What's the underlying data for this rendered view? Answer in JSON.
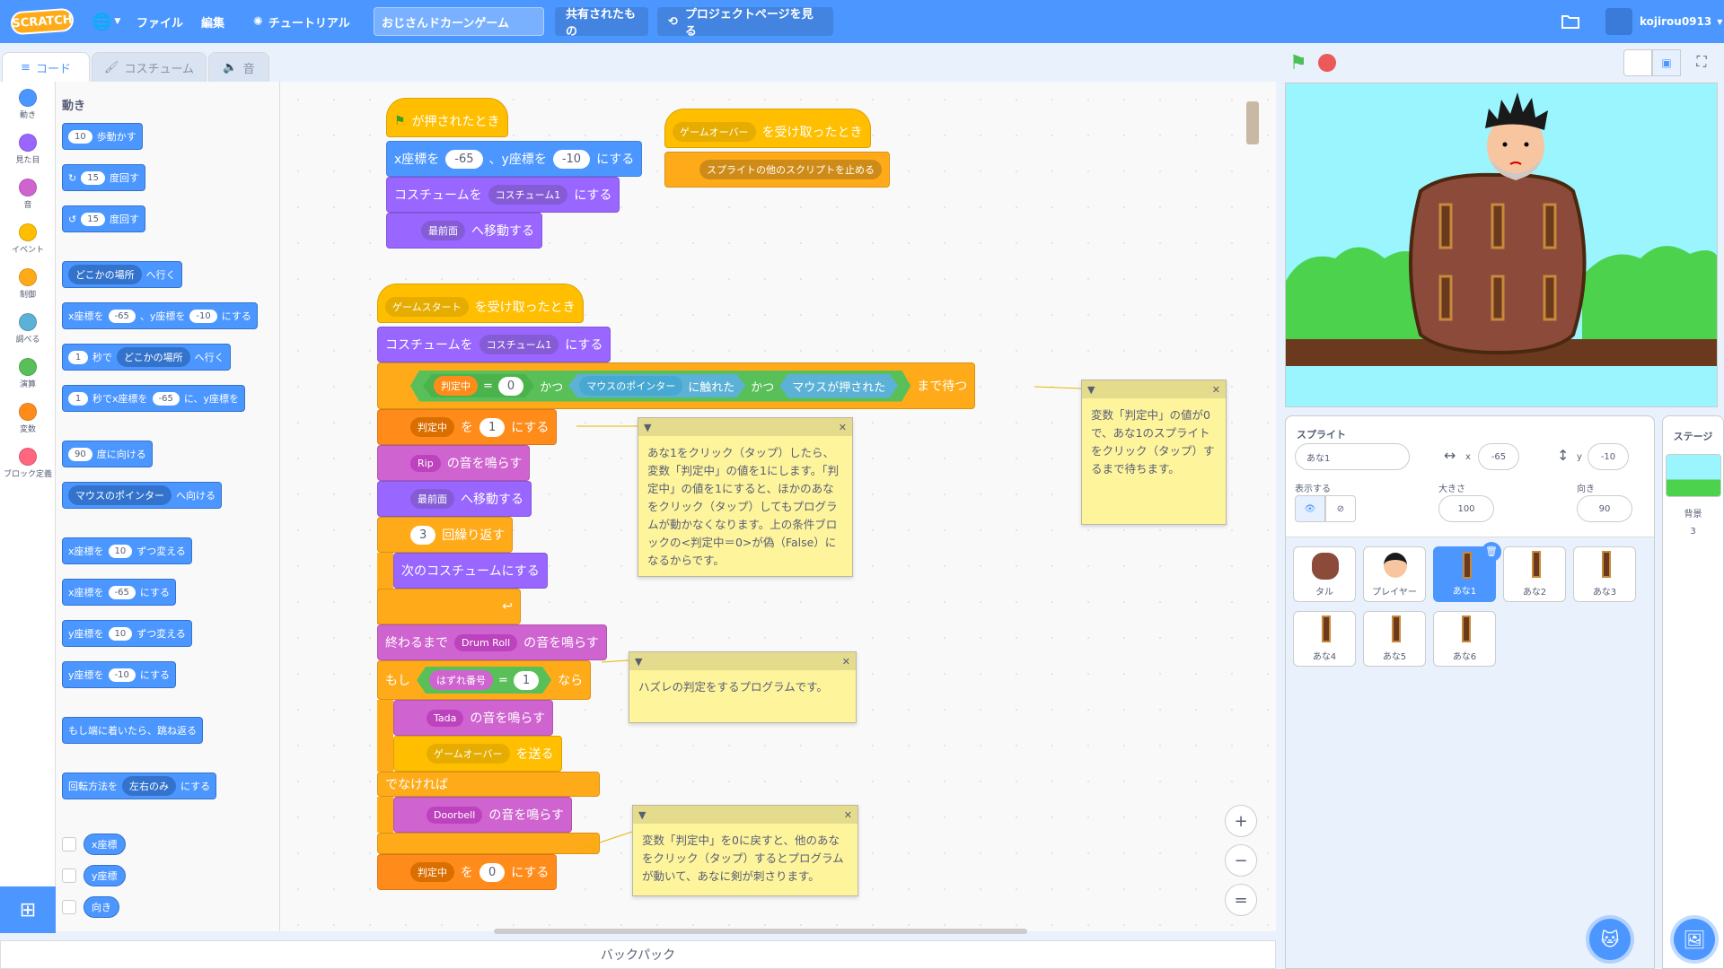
{
  "menubar": {
    "logo": "SCRATCH",
    "globe_icon": "globe-icon",
    "file": "ファイル",
    "edit": "編集",
    "tutorial": "チュートリアル",
    "project_title": "おじさんドカーンゲーム",
    "shared": "共有されたもの",
    "see_project_page": "プロジェクトページを見る",
    "username": "kojirou0913"
  },
  "tabs": {
    "code": "コード",
    "costumes": "コスチューム",
    "sounds": "音"
  },
  "categories": [
    {
      "label": "動き",
      "color": "#4c97ff"
    },
    {
      "label": "見た目",
      "color": "#9966ff"
    },
    {
      "label": "音",
      "color": "#cf63cf"
    },
    {
      "label": "イベント",
      "color": "#ffbf00"
    },
    {
      "label": "制御",
      "color": "#ffab19"
    },
    {
      "label": "調べる",
      "color": "#5cb1d6"
    },
    {
      "label": "演算",
      "color": "#59c059"
    },
    {
      "label": "変数",
      "color": "#ff8c1a"
    },
    {
      "label": "ブロック定義",
      "color": "#ff6680"
    }
  ],
  "palette": {
    "title": "動き",
    "move_n": "10",
    "move_t": "歩動かす",
    "turn_r_n": "15",
    "turn_r_t": "度回す",
    "turn_l_n": "15",
    "turn_l_t": "度回す",
    "goto_dd": "どこかの場所",
    "goto_t": "へ行く",
    "setxy_a": "x座標を",
    "setxy_x": "-65",
    "setxy_b": "、y座標を",
    "setxy_y": "-10",
    "setxy_c": "にする",
    "glide_n": "1",
    "glide_a": "秒で",
    "glide_dd": "どこかの場所",
    "glide_b": "へ行く",
    "glidexy_n": "1",
    "glidexy_a": "秒でx座標を",
    "glidexy_x": "-65",
    "glidexy_b": "に、y座標を",
    "point_n": "90",
    "point_t": "度に向ける",
    "pointto_dd": "マウスのポインター",
    "pointto_t": "へ向ける",
    "chx_a": "x座標を",
    "chx_n": "10",
    "chx_b": "ずつ変える",
    "setx_a": "x座標を",
    "setx_n": "-65",
    "setx_b": "にする",
    "chy_a": "y座標を",
    "chy_n": "10",
    "chy_b": "ずつ変える",
    "sety_a": "y座標を",
    "sety_n": "-10",
    "sety_b": "にする",
    "bounce": "もし端に着いたら、跳ね返る",
    "rot_a": "回転方法を",
    "rot_dd": "左右のみ",
    "rot_b": "にする",
    "rep_x": "x座標",
    "rep_y": "y座標",
    "rep_dir": "向き"
  },
  "scripts": {
    "s1_hat": "が押されたとき",
    "s1_b2a": "x座標を",
    "s1_b2x": "-65",
    "s1_b2b": "、y座標を",
    "s1_b2y": "-10",
    "s1_b2c": "にする",
    "s1_b3a": "コスチュームを",
    "s1_b3dd": "コスチューム1",
    "s1_b3b": "にする",
    "s1_b4dd": "最前面",
    "s1_b4b": "へ移動する",
    "s2_hatdd": "ゲームオーバー",
    "s2_hat": "を受け取ったとき",
    "s2_b2dd": "スプライトの他のスクリプトを止める",
    "s3_hatdd": "ゲームスタート",
    "s3_hat": "を受け取ったとき",
    "s3_b2a": "コスチュームを",
    "s3_b2dd": "コスチューム1",
    "s3_b2b": "にする",
    "s3_var1": "判定中",
    "s3_eq1": "=",
    "s3_zero": "0",
    "s3_and1": "かつ",
    "s3_touchdd": "マウスのポインター",
    "s3_touch": "に触れた",
    "s3_and2": "かつ",
    "s3_mouse": "マウスが押された",
    "s3_wait": "まで待つ",
    "s3_set1a": "判定中",
    "s3_set1b": "を",
    "s3_set1n": "1",
    "s3_set1c": "にする",
    "s3_snd1dd": "Rip",
    "s3_snd1b": "の音を鳴らす",
    "s3_frontdd": "最前面",
    "s3_frontb": "へ移動する",
    "s3_repn": "3",
    "s3_rept": "回繰り返す",
    "s3_next": "次のコスチュームにする",
    "s3_playuntil_a": "終わるまで",
    "s3_playuntil_dd": "Drum Roll",
    "s3_playuntil_b": "の音を鳴らす",
    "s3_if": "もし",
    "s3_ifvar": "はずれ番号",
    "s3_ifeq": "=",
    "s3_ifn": "1",
    "s3_then": "なら",
    "s3_tadadd": "Tada",
    "s3_tadab": "の音を鳴らす",
    "s3_broaddd": "ゲームオーバー",
    "s3_broadb": "を送る",
    "s3_else": "でなければ",
    "s3_doordd": "Doorbell",
    "s3_doorb": "の音を鳴らす",
    "s3_set0a": "判定中",
    "s3_set0b": "を",
    "s3_set0n": "0",
    "s3_set0c": "にする"
  },
  "comments": {
    "c1": "変数「判定中」の値が0で、あな1のスプライトをクリック（タップ）するまで待ちます。",
    "c2": "あな1をクリック（タップ）したら、変数「判定中」の値を1にします。「判定中」の値を1にすると、ほかのあなをクリック（タップ）してもプログラムが動かなくなります。上の条件ブロックの<判定中＝0>が偽（False）になるからです。",
    "c3": "ハズレの判定をするプログラムです。",
    "c4": "変数「判定中」を0に戻すと、他のあなをクリック（タップ）するとプログラムが動いて、あなに剣が刺さります。"
  },
  "zoom": {
    "in": "+",
    "out": "−",
    "reset": "="
  },
  "backpack": "バックパック",
  "sprite_pane": {
    "sprite_label": "スプライト",
    "name": "あな1",
    "x_label": "x",
    "x": "-65",
    "y_label": "y",
    "y": "-10",
    "show_label": "表示する",
    "size_label": "大きさ",
    "size": "100",
    "dir_label": "向き",
    "dir": "90"
  },
  "sprites": [
    "タル",
    "プレイヤー",
    "あな1",
    "あな2",
    "あな3",
    "あな4",
    "あな5",
    "あな6"
  ],
  "stage_pane": {
    "title": "ステージ",
    "backdrops_label": "背景",
    "backdrops_count": "3"
  }
}
